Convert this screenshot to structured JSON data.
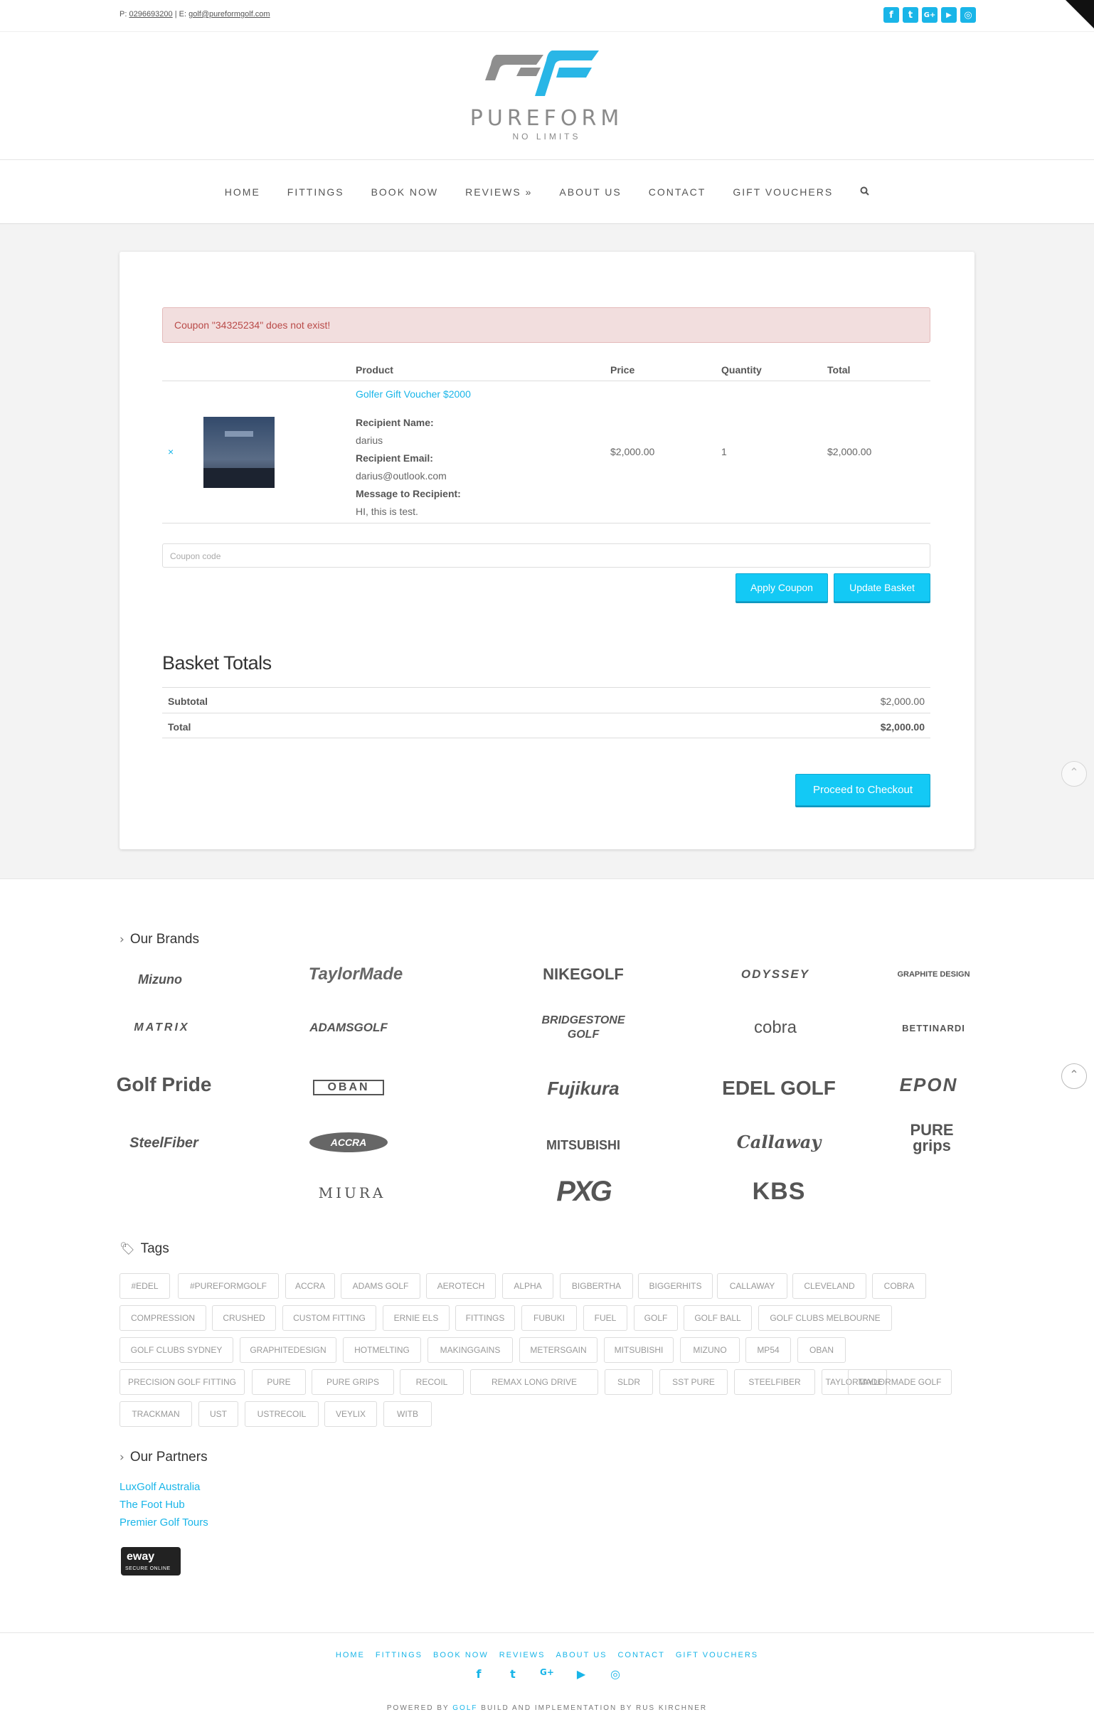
{
  "topbar": {
    "phone_prefix": "P:",
    "phone": "0296693200",
    "sep": "| E:",
    "email": "golf@pureformgolf.com",
    "social": [
      "f",
      "t",
      "G+",
      "▶",
      "◎"
    ]
  },
  "logo": {
    "wordmark": "PUREFORM",
    "tagline": "NO LIMITS"
  },
  "nav": {
    "items": [
      "HOME",
      "FITTINGS",
      "BOOK NOW",
      "REVIEWS »",
      "ABOUT US",
      "CONTACT",
      "GIFT VOUCHERS"
    ],
    "search_icon": "search-icon"
  },
  "alert": {
    "text": "Coupon \"34325234\" does not exist!"
  },
  "cart": {
    "headers": {
      "product": "Product",
      "price": "Price",
      "quantity": "Quantity",
      "total": "Total"
    },
    "item": {
      "remove": "×",
      "name": "Golfer Gift Voucher $2000",
      "recipient_name_label": "Recipient Name:",
      "recipient_name": "darius",
      "recipient_email_label": "Recipient Email:",
      "recipient_email": "darius@outlook.com",
      "message_label": "Message to Recipient:",
      "message": "HI, this is test.",
      "price": "$2,000.00",
      "quantity": "1",
      "total": "$2,000.00"
    },
    "coupon_placeholder": "Coupon code",
    "apply_label": "Apply Coupon",
    "update_label": "Update Basket"
  },
  "totals": {
    "title": "Basket Totals",
    "subtotal_label": "Subtotal",
    "subtotal": "$2,000.00",
    "total_label": "Total",
    "total": "$2,000.00",
    "checkout_label": "Proceed to Checkout"
  },
  "brands": {
    "title": "Our Brands",
    "items": [
      "Mizuno",
      "TaylorMade",
      "NIKEGOLF",
      "ODYSSEY",
      "GRAPHITE DESIGN",
      "MATRIX",
      "ADAMSGOLF",
      "BRIDGESTONE GOLF",
      "cobra",
      "BETTINARDI",
      "Golf Pride",
      "OBAN",
      "Fujikura",
      "EDEL GOLF",
      "EPON",
      "SteelFiber",
      "ACCRA",
      "MITSUBISHI",
      "Callaway",
      "PURE grips",
      "MIURA",
      "PXG",
      "KBS"
    ]
  },
  "tags": {
    "title": "Tags",
    "items": [
      "#EDEL",
      "#PUREFORMGOLF",
      "ACCRA",
      "ADAMS GOLF",
      "AEROTECH",
      "ALPHA",
      "BIGBERTHA",
      "BIGGERHITS",
      "CALLAWAY",
      "CLEVELAND",
      "COBRA",
      "COMPRESSION",
      "CRUSHED",
      "CUSTOM FITTING",
      "ERNIE ELS",
      "FITTINGS",
      "FUBUKI",
      "FUEL",
      "GOLF",
      "GOLF BALL",
      "GOLF CLUBS MELBOURNE",
      "GOLF CLUBS SYDNEY",
      "GRAPHITEDESIGN",
      "HOTMELTING",
      "MAKINGGAINS",
      "METERSGAIN",
      "MITSUBISHI",
      "MIZUNO",
      "MP54",
      "OBAN",
      "PRECISION GOLF FITTING",
      "PURE",
      "PURE GRIPS",
      "RECOIL",
      "REMAX LONG DRIVE",
      "SLDR",
      "SST PURE",
      "STEELFIBER",
      "TAYLORMADE",
      "TAYLORMADE GOLF",
      "TRACKMAN",
      "UST",
      "USTRECOIL",
      "VEYLIX",
      "WITB"
    ]
  },
  "partners": {
    "title": "Our Partners",
    "items": [
      "LuxGolf Australia",
      "The Foot Hub",
      "Premier Golf Tours"
    ]
  },
  "eway": {
    "brand": "eway",
    "caption": "SECURE ONLINE"
  },
  "footer": {
    "nav": [
      "HOME",
      "FITTINGS",
      "BOOK NOW",
      "REVIEWS",
      "ABOUT US",
      "CONTACT",
      "GIFT VOUCHERS"
    ],
    "social": [
      "f",
      "t",
      "G+",
      "▶",
      "◎"
    ],
    "powered_prefix": "POWERED BY",
    "powered_brand": "GOLF",
    "powered_suffix": "BUILD AND IMPLEMENTATION BY RUS KIRCHNER"
  },
  "colors": {
    "accent": "#19b5e8",
    "button": "#13c9f5",
    "alert_bg": "#f2dede",
    "alert_text": "#b94a48"
  }
}
